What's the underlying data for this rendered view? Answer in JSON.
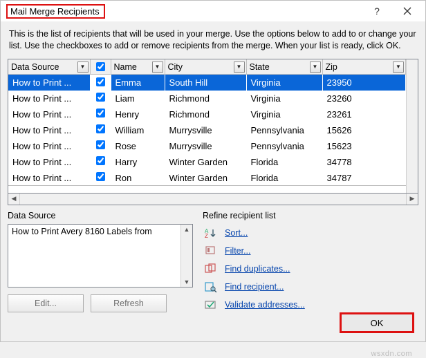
{
  "titlebar": {
    "title": "Mail Merge Recipients"
  },
  "instruction": "This is the list of recipients that will be used in your merge.  Use the options below to add to or change your list.  Use the checkboxes to add or remove recipients from the merge.  When your list is ready, click OK.",
  "columns": {
    "c0": "Data Source",
    "c2": "Name",
    "c3": "City",
    "c4": "State",
    "c5": "Zip"
  },
  "rows": [
    {
      "ds": "How to Print ...",
      "chk": true,
      "name": "Emma",
      "city": "South Hill",
      "state": "Virginia",
      "zip": "23950",
      "sel": true
    },
    {
      "ds": "How to Print ...",
      "chk": true,
      "name": "Liam",
      "city": "Richmond",
      "state": "Virginia",
      "zip": "23260"
    },
    {
      "ds": "How to Print ...",
      "chk": true,
      "name": "Henry",
      "city": "Richmond",
      "state": "Virginia",
      "zip": "23261"
    },
    {
      "ds": "How to Print ...",
      "chk": true,
      "name": "William",
      "city": "Murrysville",
      "state": "Pennsylvania",
      "zip": "15626"
    },
    {
      "ds": "How to Print ...",
      "chk": true,
      "name": "Rose",
      "city": "Murrysville",
      "state": "Pennsylvania",
      "zip": "15623"
    },
    {
      "ds": "How to Print ...",
      "chk": true,
      "name": "Harry",
      "city": "Winter Garden",
      "state": "Florida",
      "zip": "34778"
    },
    {
      "ds": "How to Print ...",
      "chk": true,
      "name": "Ron",
      "city": "Winter Garden",
      "state": "Florida",
      "zip": "34787"
    }
  ],
  "dsPanel": {
    "label": "Data Source",
    "item": "How to Print Avery 8160 Labels from",
    "edit": "Edit...",
    "refresh": "Refresh"
  },
  "refine": {
    "label": "Refine recipient list",
    "sort": "Sort...",
    "filter": "Filter...",
    "dup": "Find duplicates...",
    "find": "Find recipient...",
    "validate": "Validate addresses..."
  },
  "ok": "OK",
  "watermark": "wsxdn.com"
}
